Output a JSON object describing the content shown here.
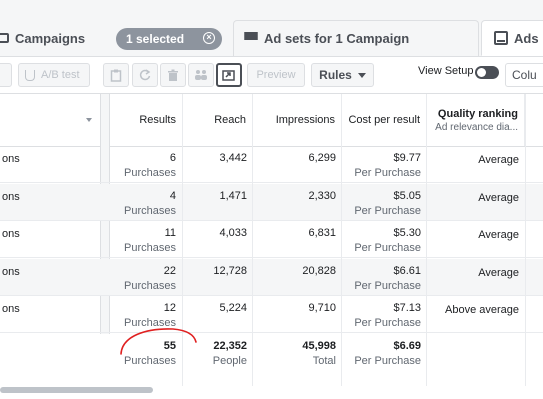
{
  "tabs": {
    "campaigns": "Campaigns",
    "selected_badge": "1 selected",
    "adsets": "Ad sets for 1 Campaign",
    "ads": "Ads"
  },
  "toolbar": {
    "ab_test": "A/B test",
    "preview": "Preview",
    "rules": "Rules",
    "view_setup": "View Setup",
    "columns": "Colu"
  },
  "table": {
    "headers": {
      "results": "Results",
      "reach": "Reach",
      "impressions": "Impressions",
      "cost_per_result": "Cost per result",
      "quality_ranking": "Quality ranking",
      "quality_sub": "Ad relevance dia..."
    },
    "rows": [
      {
        "name": "ons",
        "results": "6",
        "results_sub": "Purchases",
        "reach": "3,442",
        "impressions": "6,299",
        "cost": "$9.77",
        "cost_sub": "Per Purchase",
        "quality": "Average"
      },
      {
        "name": "ons",
        "results": "4",
        "results_sub": "Purchases",
        "reach": "1,471",
        "impressions": "2,330",
        "cost": "$5.05",
        "cost_sub": "Per Purchase",
        "quality": "Average"
      },
      {
        "name": "ons",
        "results": "11",
        "results_sub": "Purchases",
        "reach": "4,033",
        "impressions": "6,831",
        "cost": "$5.30",
        "cost_sub": "Per Purchase",
        "quality": "Average"
      },
      {
        "name": "ons",
        "results": "22",
        "results_sub": "Purchases",
        "reach": "12,728",
        "impressions": "20,828",
        "cost": "$6.61",
        "cost_sub": "Per Purchase",
        "quality": "Average"
      },
      {
        "name": "ons",
        "results": "12",
        "results_sub": "Purchases",
        "reach": "5,224",
        "impressions": "9,710",
        "cost": "$7.13",
        "cost_sub": "Per Purchase",
        "quality": "Above average"
      }
    ],
    "total": {
      "results": "55",
      "results_sub": "Purchases",
      "reach": "22,352",
      "reach_sub": "People",
      "impressions": "45,998",
      "impressions_sub": "Total",
      "cost": "$6.69",
      "cost_sub": "Per Purchase"
    }
  },
  "colors": {
    "badge": "#8d949e",
    "annotation": "#e02020",
    "alt_row": "#f5f6f7",
    "border": "#dddfe2"
  }
}
